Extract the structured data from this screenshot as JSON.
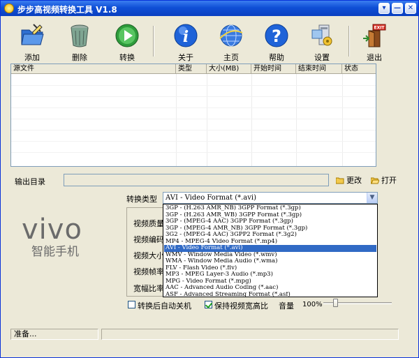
{
  "window": {
    "title": "步步高视频转换工具 V1.8",
    "controls": [
      "▾",
      "—",
      "✕"
    ]
  },
  "toolbar": {
    "add": "添加",
    "delete": "删除",
    "convert": "转换",
    "about": "关于",
    "home": "主页",
    "help": "帮助",
    "settings": "设置",
    "exit": "退出",
    "exit_sign": "EXIT",
    "help_mark": "?",
    "about_mark": "i"
  },
  "file_list": {
    "columns": [
      "源文件",
      "类型",
      "大小(MB)",
      "开始时间",
      "结束时间",
      "状态"
    ]
  },
  "output": {
    "label": "输出目录",
    "value": "",
    "change_label": "更改",
    "open_label": "打开"
  },
  "convert": {
    "type_label": "转换类型",
    "selected": "AVI - Video Format (*.avi)",
    "options": [
      "3GP - (H.263 AMR_NB) 3GPP Format (*.3gp)",
      "3GP - (H.263 AMR_WB) 3GPP Format (*.3gp)",
      "3GP - (MPEG-4 AAC) 3GPP Format (*.3gp)",
      "3GP - (MPEG-4 AMR_NB) 3GPP Format (*.3gp)",
      "3G2 - (MPEG-4 AAC) 3GPP2 Format (*.3g2)",
      "MP4 - MPEG-4 Video Format (*.mp4)",
      "AVI - Video Format (*.avi)",
      "WMV - Window Media Video (*.wmv)",
      "WMA - Window Media Audio (*.wma)",
      "FLV - Flash Video (*.flv)",
      "MP3 - MPEG Layer-3 Audio (*.mp3)",
      "MPG - Video Format (*.mpg)",
      "AAC - Advanced Audio Coding (*.aac)",
      "ASF - Advanced Streaming Format (*.asf)"
    ],
    "selected_index": 6
  },
  "video_settings": {
    "labels": [
      "视频质量",
      "视频编码",
      "视频大小",
      "视频帧率",
      "宽幅比率"
    ]
  },
  "options": {
    "auto_shutdown_label": "转换后自动关机",
    "auto_shutdown_checked": false,
    "keep_aspect_label": "保持视频宽高比",
    "keep_aspect_checked": true,
    "volume_label": "音量",
    "volume_value": "100%",
    "volume_fraction": 0.15
  },
  "status": {
    "text": "准备..."
  },
  "brand": {
    "logo_text": "vivo",
    "tagline": "智能手机"
  }
}
